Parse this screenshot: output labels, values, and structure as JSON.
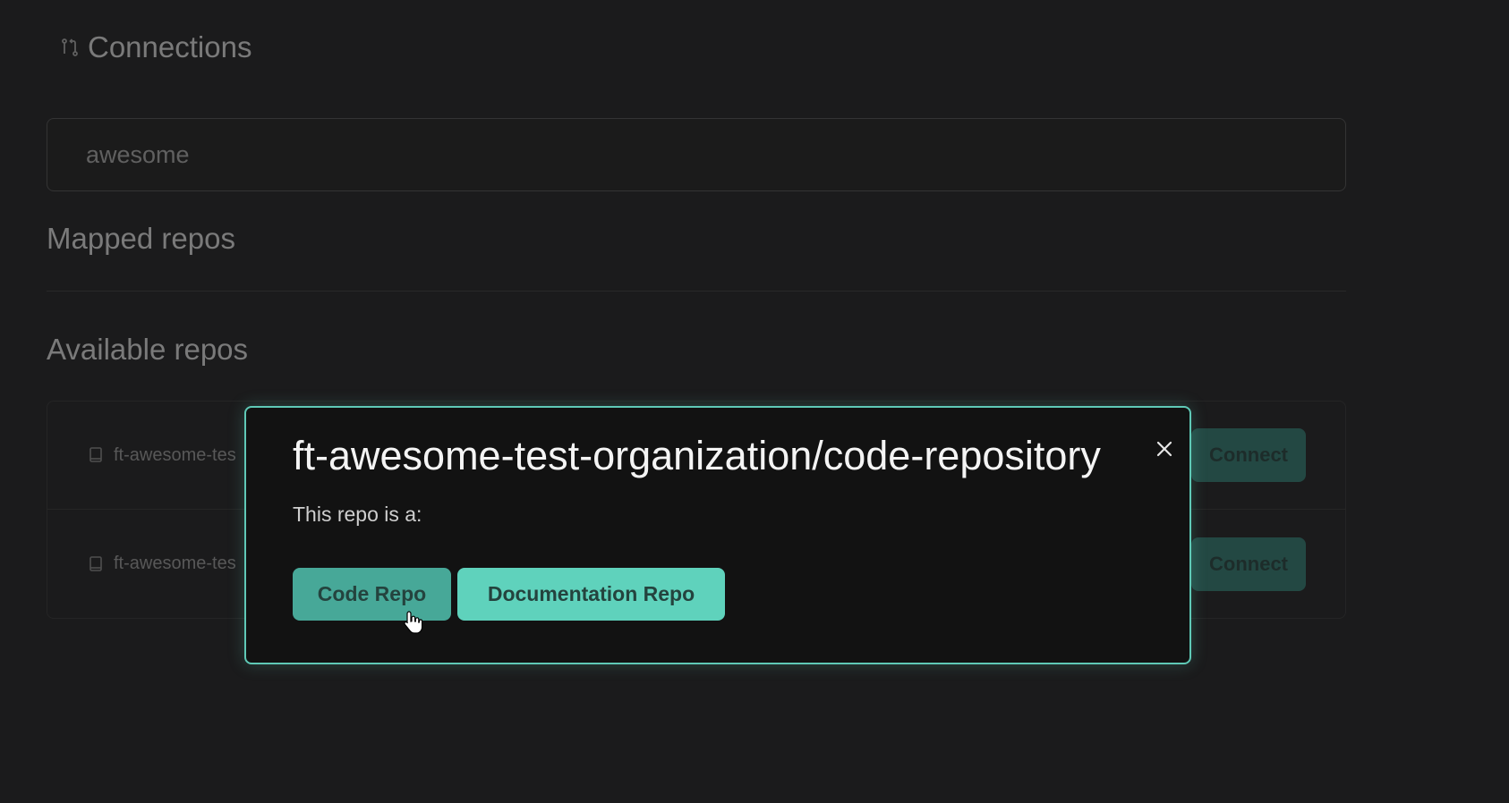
{
  "header": {
    "title": "Connections",
    "icon": "git-compare-icon"
  },
  "search": {
    "value": "awesome"
  },
  "sections": {
    "mapped_title": "Mapped repos",
    "available_title": "Available repos"
  },
  "repos": [
    {
      "name": "ft-awesome-tes",
      "connect_label": "Connect"
    },
    {
      "name": "ft-awesome-tes",
      "connect_label": "Connect"
    }
  ],
  "modal": {
    "title": "ft-awesome-test-organization/code-repository",
    "subtitle": "This repo is a:",
    "code_button": "Code Repo",
    "docs_button": "Documentation Repo",
    "close_icon": "close-icon"
  },
  "colors": {
    "background": "#1b1b1c",
    "accent": "#5fd2bc",
    "accent_dark": "#47a898",
    "modal_border": "#5fc9b6"
  }
}
